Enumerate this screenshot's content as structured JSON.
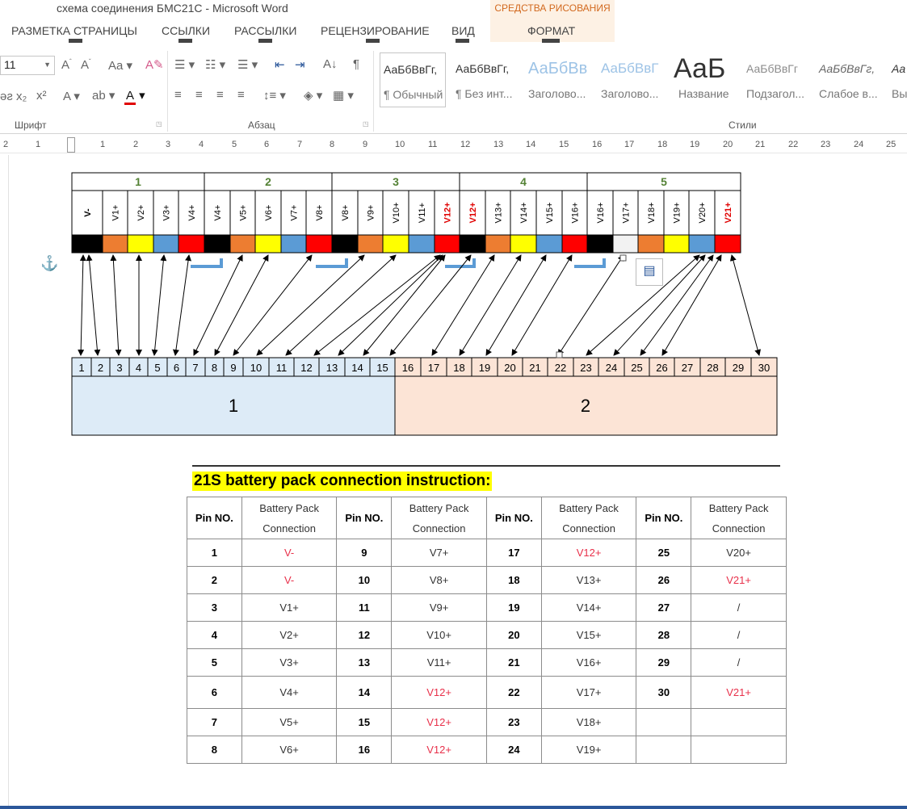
{
  "window": {
    "title": "схема соединения БМС21С - Microsoft Word"
  },
  "context_tab": {
    "group_title": "СРЕДСТВА РИСОВАНИЯ",
    "tab_label": "ФОРМАТ",
    "keytip": "БТ"
  },
  "tabs": [
    {
      "label": "РАЗМЕТКА СТРАНИЦЫ",
      "keytip": "З"
    },
    {
      "label": "ССЫЛКИ",
      "keytip": "К"
    },
    {
      "label": "РАССЫЛКИ",
      "keytip": "Л"
    },
    {
      "label": "РЕЦЕНЗИРОВАНИЕ",
      "keytip": "И"
    },
    {
      "label": "ВИД",
      "keytip": "О"
    }
  ],
  "ribbon": {
    "font_size": "11",
    "groups": {
      "font": "Шрифт",
      "paragraph": "Абзац",
      "styles": "Стили"
    },
    "styles": [
      {
        "preview": "АаБбВвГг,",
        "name": "¶ Обычный"
      },
      {
        "preview": "АаБбВвГг,",
        "name": "¶ Без инт..."
      },
      {
        "preview": "АаБбВв",
        "name": "Заголово..."
      },
      {
        "preview": "АаБбВвГ",
        "name": "Заголово..."
      },
      {
        "preview": "АаБ",
        "name": "Название"
      },
      {
        "preview": "АаБбВвГг",
        "name": "Подзагол..."
      },
      {
        "preview": "АаБбВвГг,",
        "name": "Слабое в..."
      },
      {
        "preview": "Аа",
        "name": "Вы"
      }
    ]
  },
  "ruler": [
    "2",
    "1",
    "1",
    "2",
    "3",
    "4",
    "5",
    "6",
    "7",
    "8",
    "9",
    "10",
    "11",
    "12",
    "13",
    "14",
    "15",
    "16",
    "17",
    "18",
    "19",
    "20",
    "21",
    "22",
    "23",
    "24",
    "25"
  ],
  "diagram": {
    "cell_groups": [
      {
        "label": "1",
        "cells": [
          {
            "label": "V-",
            "color": "#000000",
            "red": false
          },
          {
            "label": "V1+",
            "color": "#ed7d31",
            "red": false
          },
          {
            "label": "V2+",
            "color": "#ffff00",
            "red": false
          },
          {
            "label": "V3+",
            "color": "#5b9bd5",
            "red": false
          },
          {
            "label": "V4+",
            "color": "#ff0000",
            "red": false
          }
        ]
      },
      {
        "label": "2",
        "cells": [
          {
            "label": "V4+",
            "color": "#000000",
            "red": false
          },
          {
            "label": "V5+",
            "color": "#ed7d31",
            "red": false
          },
          {
            "label": "V6+",
            "color": "#ffff00",
            "red": false
          },
          {
            "label": "V7+",
            "color": "#5b9bd5",
            "red": false
          },
          {
            "label": "V8+",
            "color": "#ff0000",
            "red": false
          }
        ]
      },
      {
        "label": "3",
        "cells": [
          {
            "label": "V8+",
            "color": "#000000",
            "red": false
          },
          {
            "label": "V9+",
            "color": "#ed7d31",
            "red": false
          },
          {
            "label": "V10+",
            "color": "#ffff00",
            "red": false
          },
          {
            "label": "V11+",
            "color": "#5b9bd5",
            "red": false
          },
          {
            "label": "V12+",
            "color": "#ff0000",
            "red": true
          }
        ]
      },
      {
        "label": "4",
        "cells": [
          {
            "label": "V12+",
            "color": "#000000",
            "red": true
          },
          {
            "label": "V13+",
            "color": "#ed7d31",
            "red": false
          },
          {
            "label": "V14+",
            "color": "#ffff00",
            "red": false
          },
          {
            "label": "V15+",
            "color": "#5b9bd5",
            "red": false
          },
          {
            "label": "V16+",
            "color": "#ff0000",
            "red": false
          }
        ]
      },
      {
        "label": "5",
        "cells": [
          {
            "label": "V16+",
            "color": "#000000",
            "red": false
          },
          {
            "label": "V17+",
            "color": "#f2f2f2",
            "red": false
          },
          {
            "label": "V18+",
            "color": "#ed7d31",
            "red": false
          },
          {
            "label": "V19+",
            "color": "#ffff00",
            "red": false
          },
          {
            "label": "V20+",
            "color": "#5b9bd5",
            "red": false
          },
          {
            "label": "V21+",
            "color": "#ff0000",
            "red": true
          }
        ]
      }
    ],
    "pins": [
      "1",
      "2",
      "3",
      "4",
      "5",
      "6",
      "7",
      "8",
      "9",
      "10",
      "11",
      "12",
      "13",
      "14",
      "15",
      "16",
      "17",
      "18",
      "19",
      "20",
      "21",
      "22",
      "23",
      "24",
      "25",
      "26",
      "27",
      "28",
      "29",
      "30"
    ],
    "blocks": [
      {
        "label": "1",
        "color": "#ddebf7"
      },
      {
        "label": "2",
        "color": "#fce4d6"
      }
    ]
  },
  "instruction": {
    "title": "21S battery pack connection instruction:",
    "header": {
      "pin": "Pin NO.",
      "conn_line1": "Battery Pack",
      "conn_line2": "Connection"
    },
    "rows": [
      [
        {
          "pin": "1",
          "conn": "V-",
          "red": true
        },
        {
          "pin": "9",
          "conn": "V7+",
          "red": false
        },
        {
          "pin": "17",
          "conn": "V12+",
          "red": true
        },
        {
          "pin": "25",
          "conn": "V20+",
          "red": false
        }
      ],
      [
        {
          "pin": "2",
          "conn": "V-",
          "red": true
        },
        {
          "pin": "10",
          "conn": "V8+",
          "red": false
        },
        {
          "pin": "18",
          "conn": "V13+",
          "red": false
        },
        {
          "pin": "26",
          "conn": "V21+",
          "red": true
        }
      ],
      [
        {
          "pin": "3",
          "conn": "V1+",
          "red": false
        },
        {
          "pin": "11",
          "conn": "V9+",
          "red": false
        },
        {
          "pin": "19",
          "conn": "V14+",
          "red": false
        },
        {
          "pin": "27",
          "conn": "/",
          "red": false
        }
      ],
      [
        {
          "pin": "4",
          "conn": "V2+",
          "red": false
        },
        {
          "pin": "12",
          "conn": "V10+",
          "red": false
        },
        {
          "pin": "20",
          "conn": "V15+",
          "red": false
        },
        {
          "pin": "28",
          "conn": "/",
          "red": false
        }
      ],
      [
        {
          "pin": "5",
          "conn": "V3+",
          "red": false
        },
        {
          "pin": "13",
          "conn": "V11+",
          "red": false
        },
        {
          "pin": "21",
          "conn": "V16+",
          "red": false
        },
        {
          "pin": "29",
          "conn": "/",
          "red": false
        }
      ],
      [
        {
          "pin": "6",
          "conn": "V4+",
          "red": false
        },
        {
          "pin": "14",
          "conn": "V12+",
          "red": true
        },
        {
          "pin": "22",
          "conn": "V17+",
          "red": false
        },
        {
          "pin": "30",
          "conn": "V21+",
          "red": true
        }
      ],
      [
        {
          "pin": "7",
          "conn": "V5+",
          "red": false
        },
        {
          "pin": "15",
          "conn": "V12+",
          "red": true
        },
        {
          "pin": "23",
          "conn": "V18+",
          "red": false
        },
        {
          "pin": "",
          "conn": "",
          "red": false
        }
      ],
      [
        {
          "pin": "8",
          "conn": "V6+",
          "red": false
        },
        {
          "pin": "16",
          "conn": "V12+",
          "red": true
        },
        {
          "pin": "24",
          "conn": "V19+",
          "red": false
        },
        {
          "pin": "",
          "conn": "",
          "red": false
        }
      ]
    ]
  },
  "colors": {
    "accent": "#2b579a",
    "label_green": "#548235",
    "red_text": "#e8304a",
    "context_orange": "#d2691e"
  }
}
